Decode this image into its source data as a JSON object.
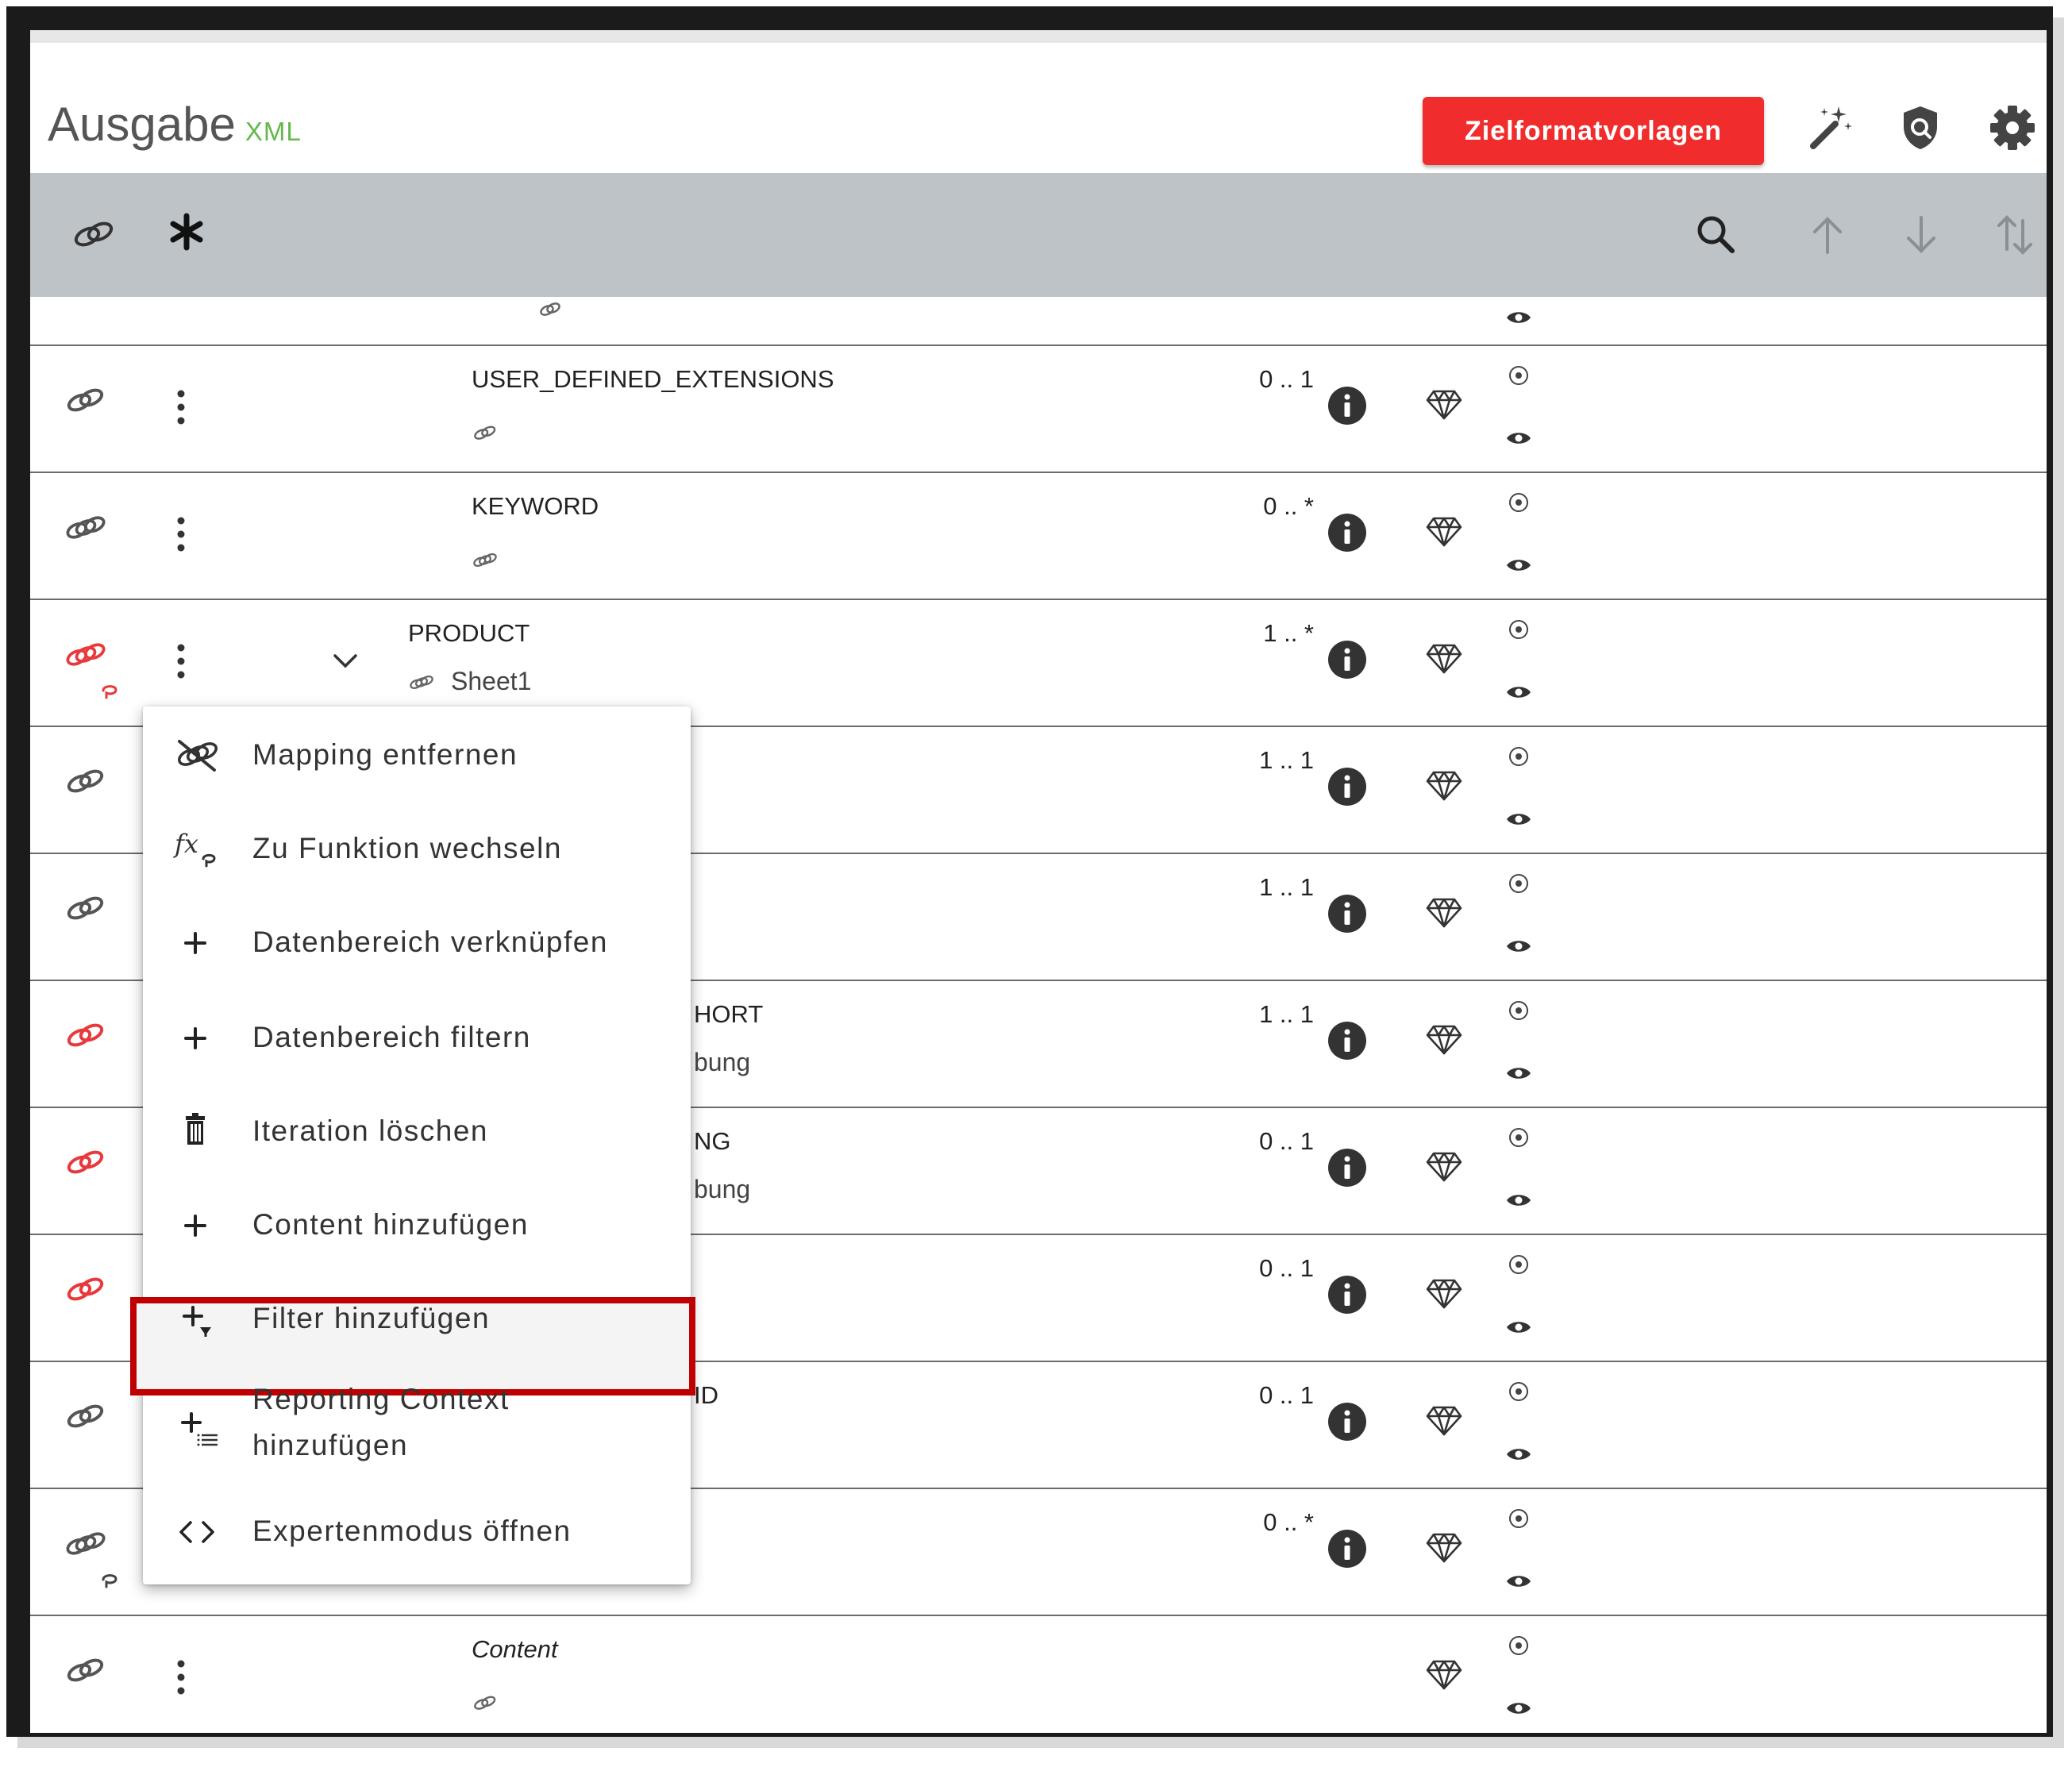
{
  "header": {
    "title": "Ausgabe",
    "title_suffix": "XML",
    "primary_button": "Zielformatvorlagen",
    "icons": [
      "magic-wand-icon",
      "shield-icon",
      "gear-icon"
    ]
  },
  "toolbar": {
    "icons": [
      "link-icon",
      "asterisk-icon",
      "search-icon",
      "arrow-up-icon",
      "arrow-down-icon",
      "sort-icon"
    ]
  },
  "rows": [
    {
      "name": "USER_DEFINED_EXTENSIONS",
      "cardinality": "0 .. 1"
    },
    {
      "name": "KEYWORD",
      "cardinality": "0 .. *"
    },
    {
      "name": "PRODUCT",
      "sub": "Sheet1",
      "cardinality": "1 .. *"
    },
    {
      "name": "",
      "cardinality": "1 .. 1"
    },
    {
      "name": "",
      "cardinality": "1 .. 1"
    },
    {
      "name": "HORT",
      "sub": "bung",
      "cardinality": "1 .. 1"
    },
    {
      "name": "NG",
      "sub": "bung",
      "cardinality": "0 .. 1"
    },
    {
      "name": "",
      "cardinality": "0 .. 1"
    },
    {
      "name": "ID",
      "cardinality": "0 .. 1"
    },
    {
      "name": "",
      "cardinality": "0 .. *"
    },
    {
      "name": "Content",
      "cardinality": ""
    }
  ],
  "context_menu": {
    "items": [
      {
        "label": "Mapping entfernen",
        "icon": "unlink-icon"
      },
      {
        "label": "Zu Funktion wechseln",
        "icon": "function-icon"
      },
      {
        "label": "Datenbereich verknüpfen",
        "icon": "plus-icon"
      },
      {
        "label": "Datenbereich filtern",
        "icon": "plus-icon"
      },
      {
        "label": "Iteration löschen",
        "icon": "trash-icon"
      },
      {
        "label": "Content hinzufügen",
        "icon": "plus-icon"
      },
      {
        "label": "Filter hinzufügen",
        "icon": "add-filter-icon",
        "highlighted": true
      },
      {
        "label": "Reporting Context",
        "label_line2": "hinzufügen",
        "icon": "add-list-icon"
      },
      {
        "label": "Expertenmodus öffnen",
        "icon": "code-icon"
      }
    ]
  },
  "colors": {
    "accent_red": "#f02c2c",
    "xml_green": "#63b84b",
    "toolbar_bg": "#bdc3c7",
    "highlight_border": "#c00000",
    "mapped_link_red": "#e8393c"
  }
}
